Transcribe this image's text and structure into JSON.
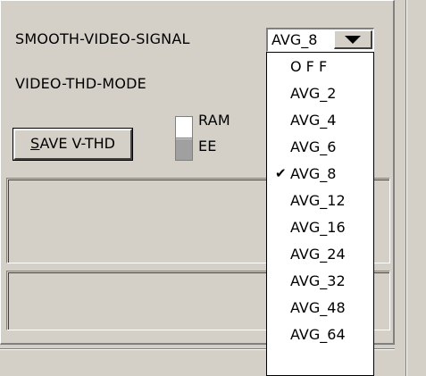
{
  "smooth_label": "SMOOTH-VIDEO-SIGNAL",
  "combo": {
    "value": "AVG_8"
  },
  "vthd_label": "VIDEO-THD-MODE",
  "save_button": {
    "prefix": "S",
    "rest": "AVE V-THD"
  },
  "memory": {
    "ram": "RAM",
    "ee": "EE"
  },
  "dropdown": {
    "items": [
      "O F F",
      "AVG_2",
      "AVG_4",
      "AVG_6",
      "AVG_8",
      "AVG_12",
      "AVG_16",
      "AVG_24",
      "AVG_32",
      "AVG_48",
      "AVG_64"
    ],
    "selected": "AVG_8"
  },
  "colors": {
    "face": "#d4d0c8",
    "shadow": "#808080",
    "highlight": "#ffffff"
  },
  "icons": {
    "combo_arrow": "triangle-down-icon",
    "check": "checkmark-icon"
  }
}
